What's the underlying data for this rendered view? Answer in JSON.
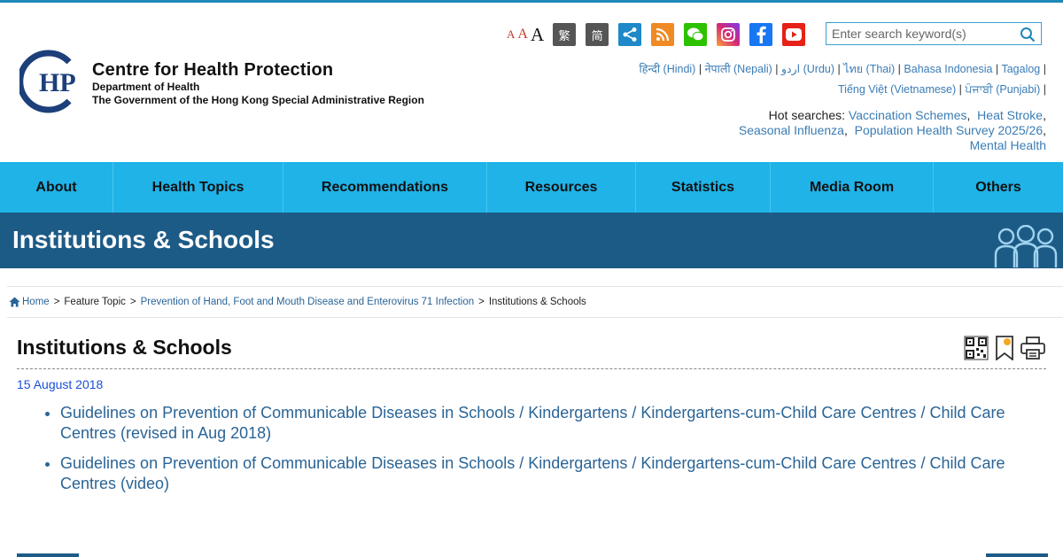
{
  "header": {
    "org_name": "Centre for Health Protection",
    "org_dept": "Department of Health",
    "org_gov": "The Government of the Hong Kong Special Administrative Region",
    "font_small": "A",
    "font_medium": "A",
    "font_large": "A",
    "trad_chinese": "繁",
    "simp_chinese": "简",
    "search_placeholder": "Enter search keyword(s)",
    "languages": [
      "हिन्दी (Hindi)",
      "नेपाली (Nepali)",
      "اردو (Urdu)",
      "ไทย (Thai)",
      "Bahasa Indonesia",
      "Tagalog",
      "Tiếng Việt (Vietnamese)",
      "ਪੰਜਾਬੀ (Punjabi)"
    ],
    "hot_label": "Hot searches:",
    "hot_searches": [
      "Vaccination Schemes",
      "Heat Stroke",
      "Seasonal Influenza",
      "Population Health Survey 2025/26",
      "Mental Health"
    ]
  },
  "nav": [
    "About",
    "Health Topics",
    "Recommendations",
    "Resources",
    "Statistics",
    "Media Room",
    "Others"
  ],
  "banner": {
    "title": "Institutions & Schools"
  },
  "breadcrumb": {
    "home": "Home",
    "feature": "Feature Topic",
    "topic": "Prevention of Hand, Foot and Mouth Disease and Enterovirus 71 Infection",
    "current": "Institutions & Schools"
  },
  "content": {
    "title": "Institutions & Schools",
    "date": "15 August 2018",
    "links": [
      "Guidelines on Prevention of Communicable Diseases in Schools / Kindergartens / Kindergartens-cum-Child Care Centres / Child Care Centres (revised in Aug 2018)",
      "Guidelines on Prevention of Communicable Diseases in Schools / Kindergartens / Kindergartens-cum-Child Care Centres / Child Care Centres (video)"
    ]
  },
  "colors": {
    "nav_bg": "#1fb3e8",
    "banner_bg": "#1d5b87",
    "link": "#2a6496",
    "date": "#1a4fd6"
  }
}
